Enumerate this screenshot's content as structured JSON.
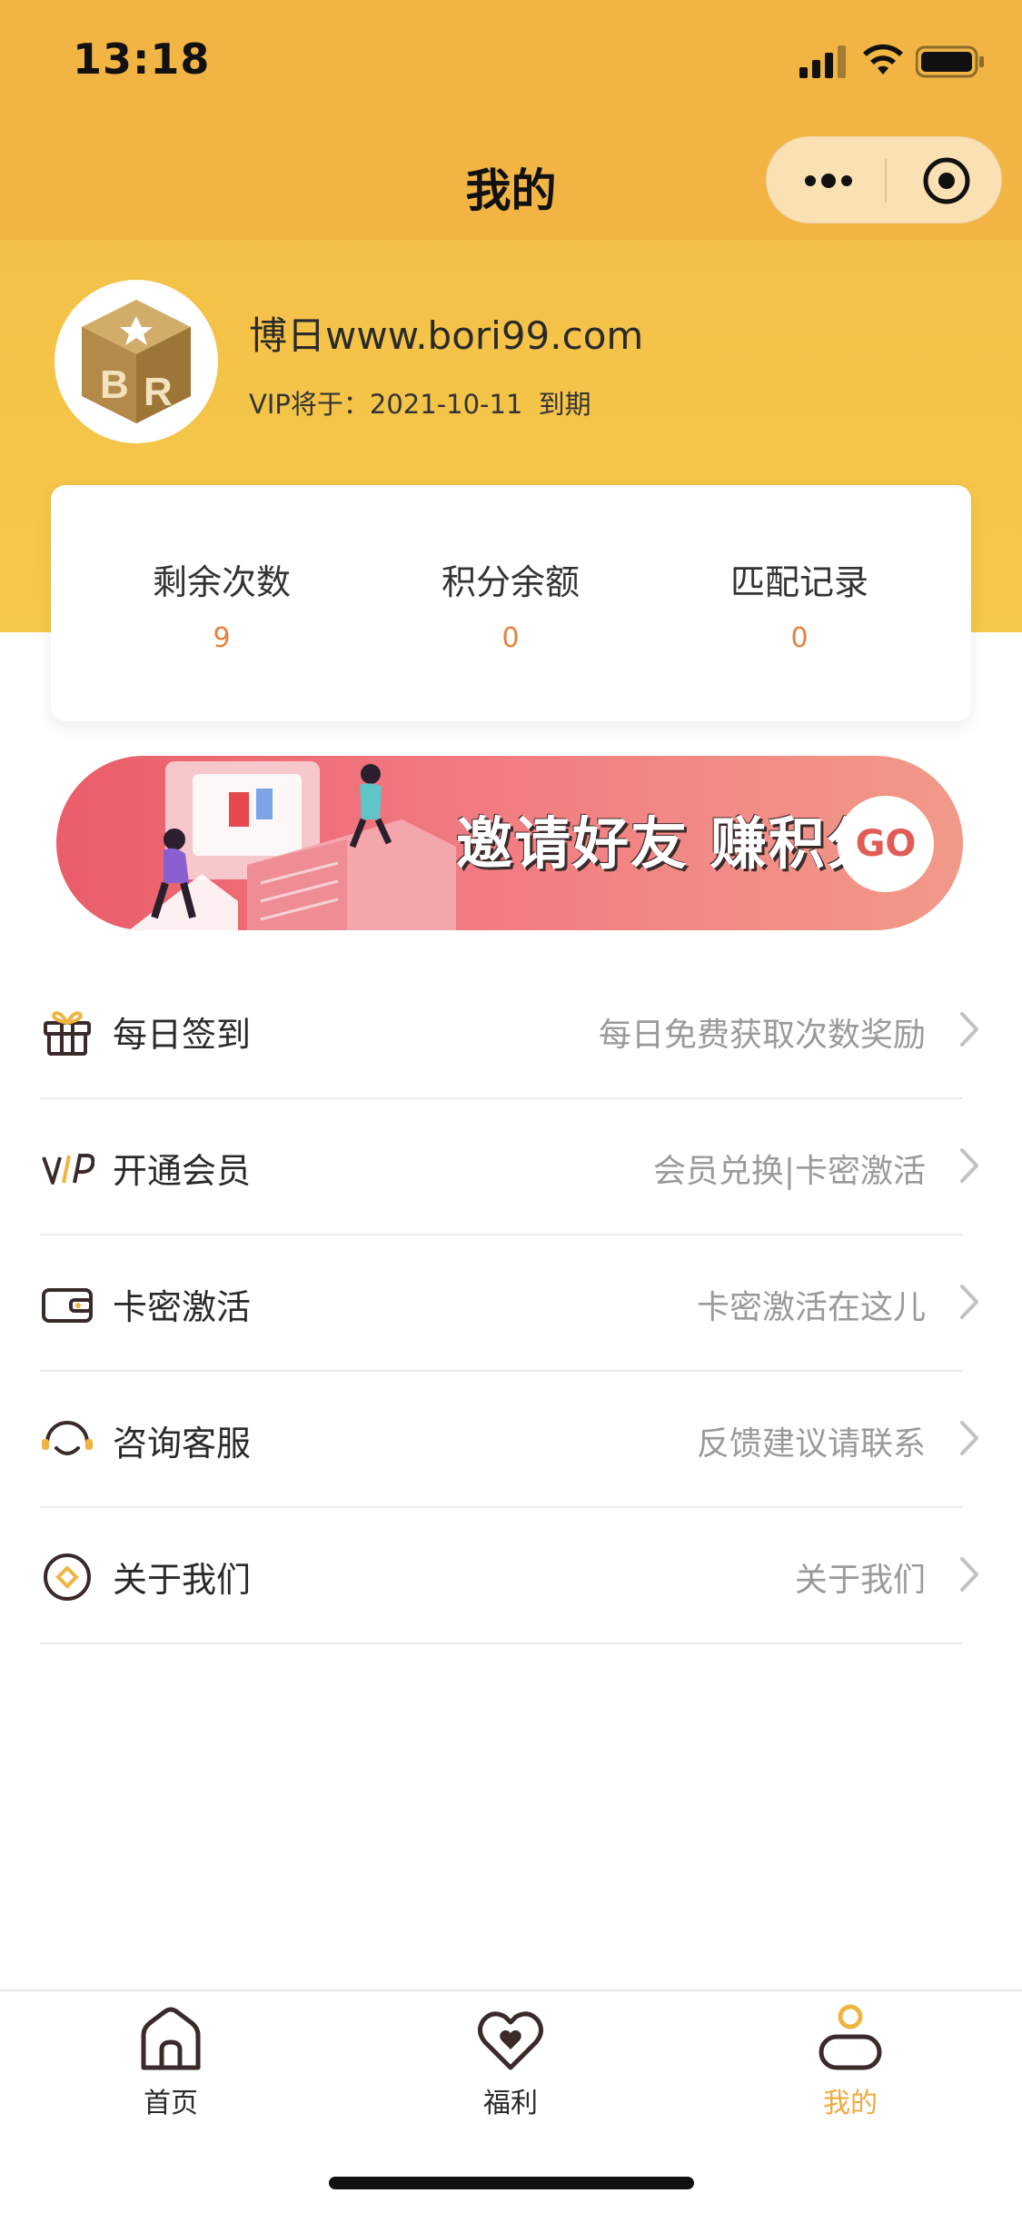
{
  "status_bar": {
    "time": "13:18"
  },
  "nav": {
    "title": "我的"
  },
  "profile": {
    "username": "博日www.bori99.com",
    "vip_prefix": "VIP将于：",
    "vip_date": "2021-10-11",
    "vip_suffix": "到期"
  },
  "stats": [
    {
      "label": "剩余次数",
      "value": "9"
    },
    {
      "label": "积分余额",
      "value": "0"
    },
    {
      "label": "匹配记录",
      "value": "0"
    }
  ],
  "banner": {
    "text": "邀请好友 赚积分",
    "go": "GO"
  },
  "menu": [
    {
      "title": "每日签到",
      "desc": "每日免费获取次数奖励",
      "icon": "gift-icon"
    },
    {
      "title": "开通会员",
      "desc": "会员兑换|卡密激活",
      "icon": "vip-icon"
    },
    {
      "title": "卡密激活",
      "desc": "卡密激活在这儿",
      "icon": "wallet-icon"
    },
    {
      "title": "咨询客服",
      "desc": "反馈建议请联系",
      "icon": "headset-icon"
    },
    {
      "title": "关于我们",
      "desc": "关于我们",
      "icon": "about-icon"
    }
  ],
  "tabbar": [
    {
      "label": "首页",
      "icon": "home-icon",
      "active": false
    },
    {
      "label": "福利",
      "icon": "heart-icon",
      "active": false
    },
    {
      "label": "我的",
      "icon": "profile-icon",
      "active": true
    }
  ],
  "colors": {
    "header": "#f3b844",
    "accent_orange": "#e8813b",
    "active_tab": "#f0a93e",
    "banner_start": "#ea5d6a",
    "banner_end": "#f19a88"
  }
}
